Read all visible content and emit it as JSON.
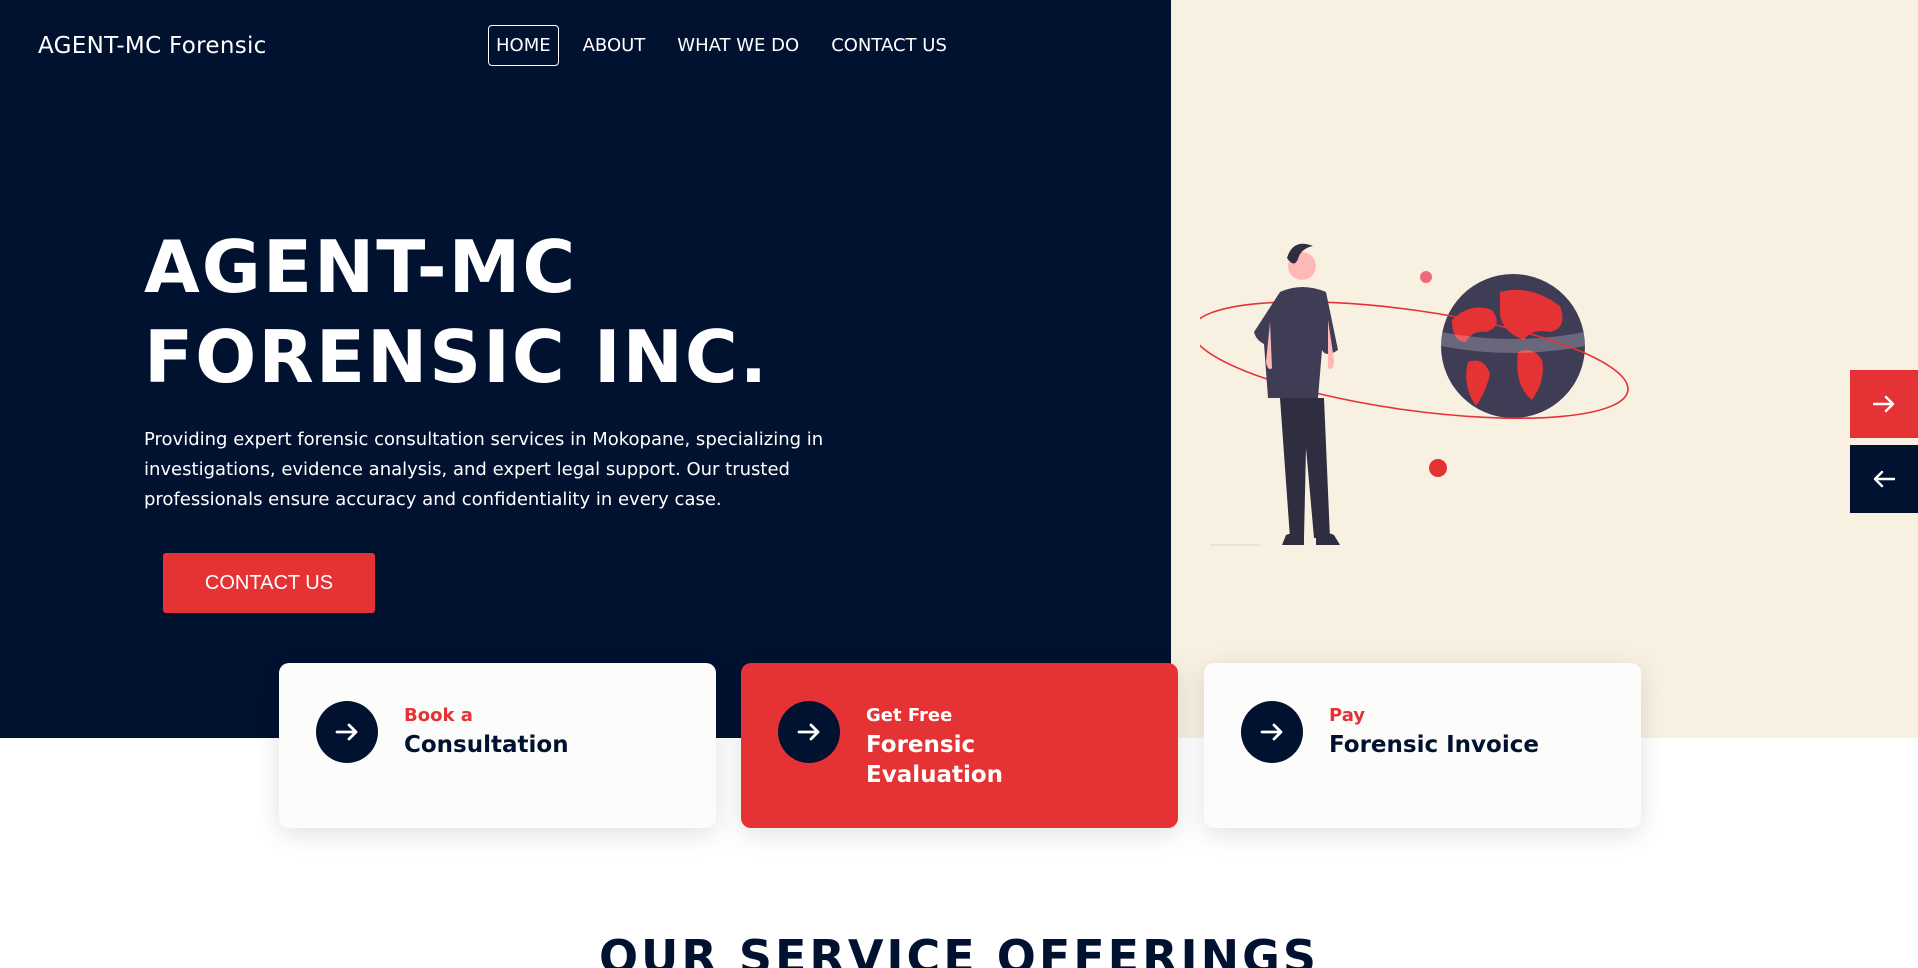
{
  "brand": {
    "name": "AGENT-MC Forensic"
  },
  "nav": {
    "items": [
      {
        "label": "HOME",
        "active": true
      },
      {
        "label": "ABOUT"
      },
      {
        "label": "WHAT WE DO"
      },
      {
        "label": "CONTACT US"
      }
    ]
  },
  "hero": {
    "title_line1": "AGENT-MC",
    "title_line2": "FORENSIC INC.",
    "description": "Providing expert forensic consultation services in Mokopane, specializing in investigations, evidence analysis, and expert legal support. Our trusted professionals ensure accuracy and confidentiality in every case.",
    "cta_label": "CONTACT US"
  },
  "slider": {
    "next_icon": "arrow-right-icon",
    "prev_icon": "arrow-left-icon"
  },
  "cards": [
    {
      "kicker": "Book a",
      "title": "Consultation",
      "icon": "arrow-right-icon"
    },
    {
      "kicker": "Get Free",
      "title": "Forensic Evaluation",
      "icon": "arrow-right-icon"
    },
    {
      "kicker": "Pay",
      "title": "Forensic Invoice",
      "icon": "arrow-right-icon"
    }
  ],
  "services": {
    "heading": "OUR SERVICE OFFERINGS"
  },
  "colors": {
    "navy": "#011231",
    "red": "#e53235",
    "cream": "#f8f1e2",
    "white": "#ffffff"
  }
}
